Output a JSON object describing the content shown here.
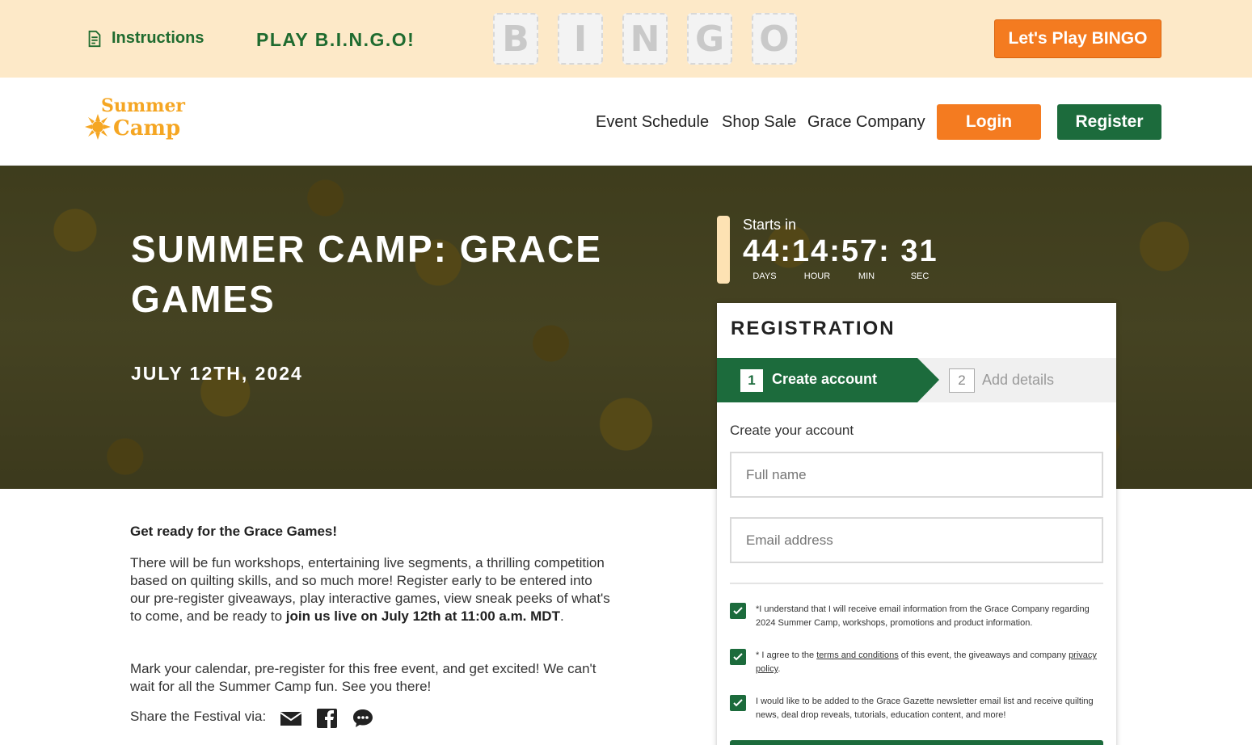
{
  "topbar": {
    "instructions_label": "Instructions",
    "play_heading": "PLAY B.I.N.G.O!",
    "bingo_letters": [
      "B",
      "I",
      "N",
      "G",
      "O"
    ],
    "play_button": "Let's Play BINGO"
  },
  "header": {
    "logo_line1": "Summer",
    "logo_line2": "Camp",
    "nav": [
      "Event Schedule",
      "Shop Sale",
      "Grace Company"
    ],
    "login": "Login",
    "register": "Register"
  },
  "hero": {
    "title": "SUMMER CAMP: GRACE GAMES",
    "date": "JULY 12TH, 2024",
    "countdown": {
      "label": "Starts in",
      "time": "44:14:57: 31",
      "units": [
        "DAYS",
        "HOUR",
        "MIN",
        "SEC"
      ]
    }
  },
  "registration": {
    "title": "REGISTRATION",
    "step1_num": "1",
    "step1_label": "Create account",
    "step2_num": "2",
    "step2_label": "Add details",
    "subtitle": "Create your account",
    "fullname_placeholder": "Full name",
    "email_placeholder": "Email address",
    "consent1": "*I understand that I will receive email information from the Grace Company regarding 2024 Summer Camp, workshops, promotions and product information.",
    "consent2_pre": "* I agree to the ",
    "consent2_link1": "terms and conditions",
    "consent2_mid": " of this event, the giveaways and company ",
    "consent2_link2": "privacy policy",
    "consent2_post": ".",
    "consent3": "I would like to be added to the Grace Gazette newsletter email list and receive quilting news, deal drop reveals, tutorials, education content, and more!"
  },
  "content": {
    "heading": "Get ready for the Grace Games!",
    "para1": "There will be fun workshops, entertaining live segments, a thrilling competition based on quilting skills, and so much more! Register early to be entered into our pre-register giveaways, play interactive games, view sneak peeks of what's to come, and be ready to ",
    "para1_bold": "join us live on July 12th at 11:00 a.m. MDT",
    "para1_end": ".",
    "para2": "Mark your calendar, pre-register for this free event, and get excited! We can't wait for all the Summer Camp fun. See you there!",
    "share_label": "Share the Festival via:"
  },
  "colors": {
    "orange": "#f47b20",
    "green": "#1c6b3c",
    "topbar_bg": "#fde9c8"
  }
}
